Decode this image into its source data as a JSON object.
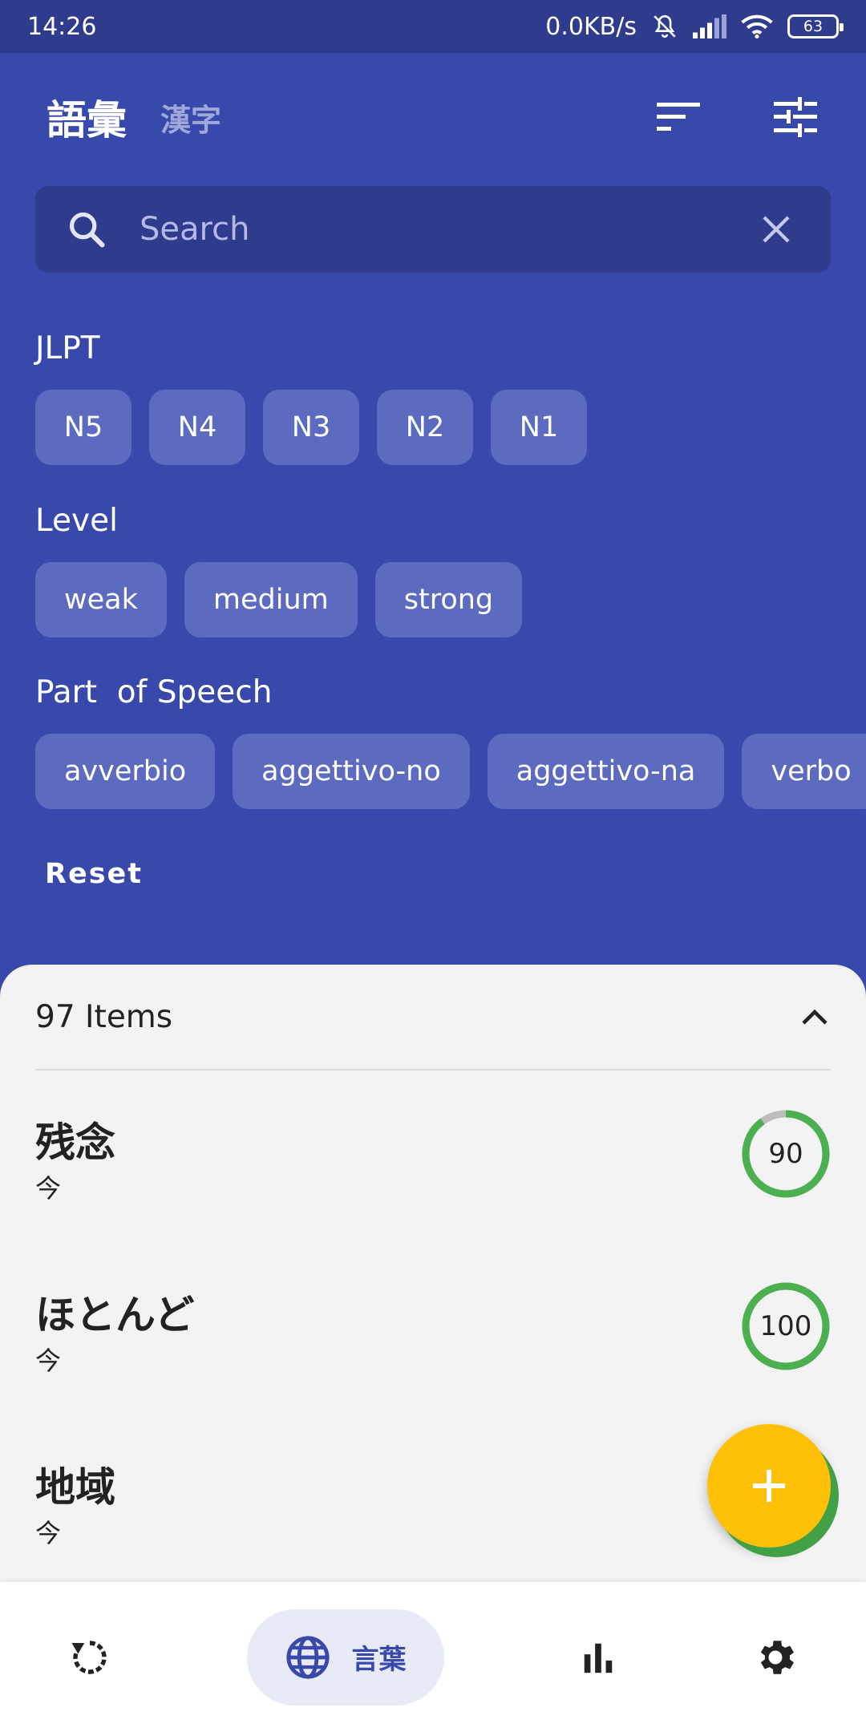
{
  "status_bar": {
    "time": "14:26",
    "network_speed": "0.0KB/s",
    "battery_level": "63",
    "icons": [
      "mute-bell-icon",
      "signal-icon",
      "wifi-icon",
      "battery-icon"
    ]
  },
  "app_bar": {
    "title": "語彙",
    "subtitle": "漢字",
    "actions": [
      "sort-icon",
      "filter-sliders-icon"
    ]
  },
  "search": {
    "placeholder": "Search",
    "value": ""
  },
  "filters": {
    "jlpt": {
      "label": "JLPT",
      "chips": [
        "N5",
        "N4",
        "N3",
        "N2",
        "N1"
      ]
    },
    "level": {
      "label": "Level",
      "chips": [
        "weak",
        "medium",
        "strong"
      ]
    },
    "part_of_speech": {
      "label": "Part  of Speech",
      "chips": [
        "avverbio",
        "aggettivo-no",
        "aggettivo-na",
        "verbo"
      ]
    },
    "reset_label": "Reset"
  },
  "list": {
    "count_label": "97 Items",
    "items": [
      {
        "word": "残念",
        "reading": "今",
        "score": "90",
        "progress": 0.9
      },
      {
        "word": "ほとんど",
        "reading": "今",
        "score": "100",
        "progress": 1.0
      },
      {
        "word": "地域",
        "reading": "今",
        "score": "",
        "progress": 0
      }
    ]
  },
  "colors": {
    "primary": "#3949ab",
    "primary_dark": "#2f3b8c",
    "chip": "#5c6bc0",
    "fab": "#ffc107",
    "score_ring": "#4caf50"
  },
  "bottom_nav": {
    "items": [
      {
        "icon": "review-refresh-icon",
        "label": ""
      },
      {
        "icon": "globe-icon",
        "label": "言葉"
      },
      {
        "icon": "bar-chart-icon",
        "label": ""
      },
      {
        "icon": "gear-icon",
        "label": ""
      }
    ]
  }
}
